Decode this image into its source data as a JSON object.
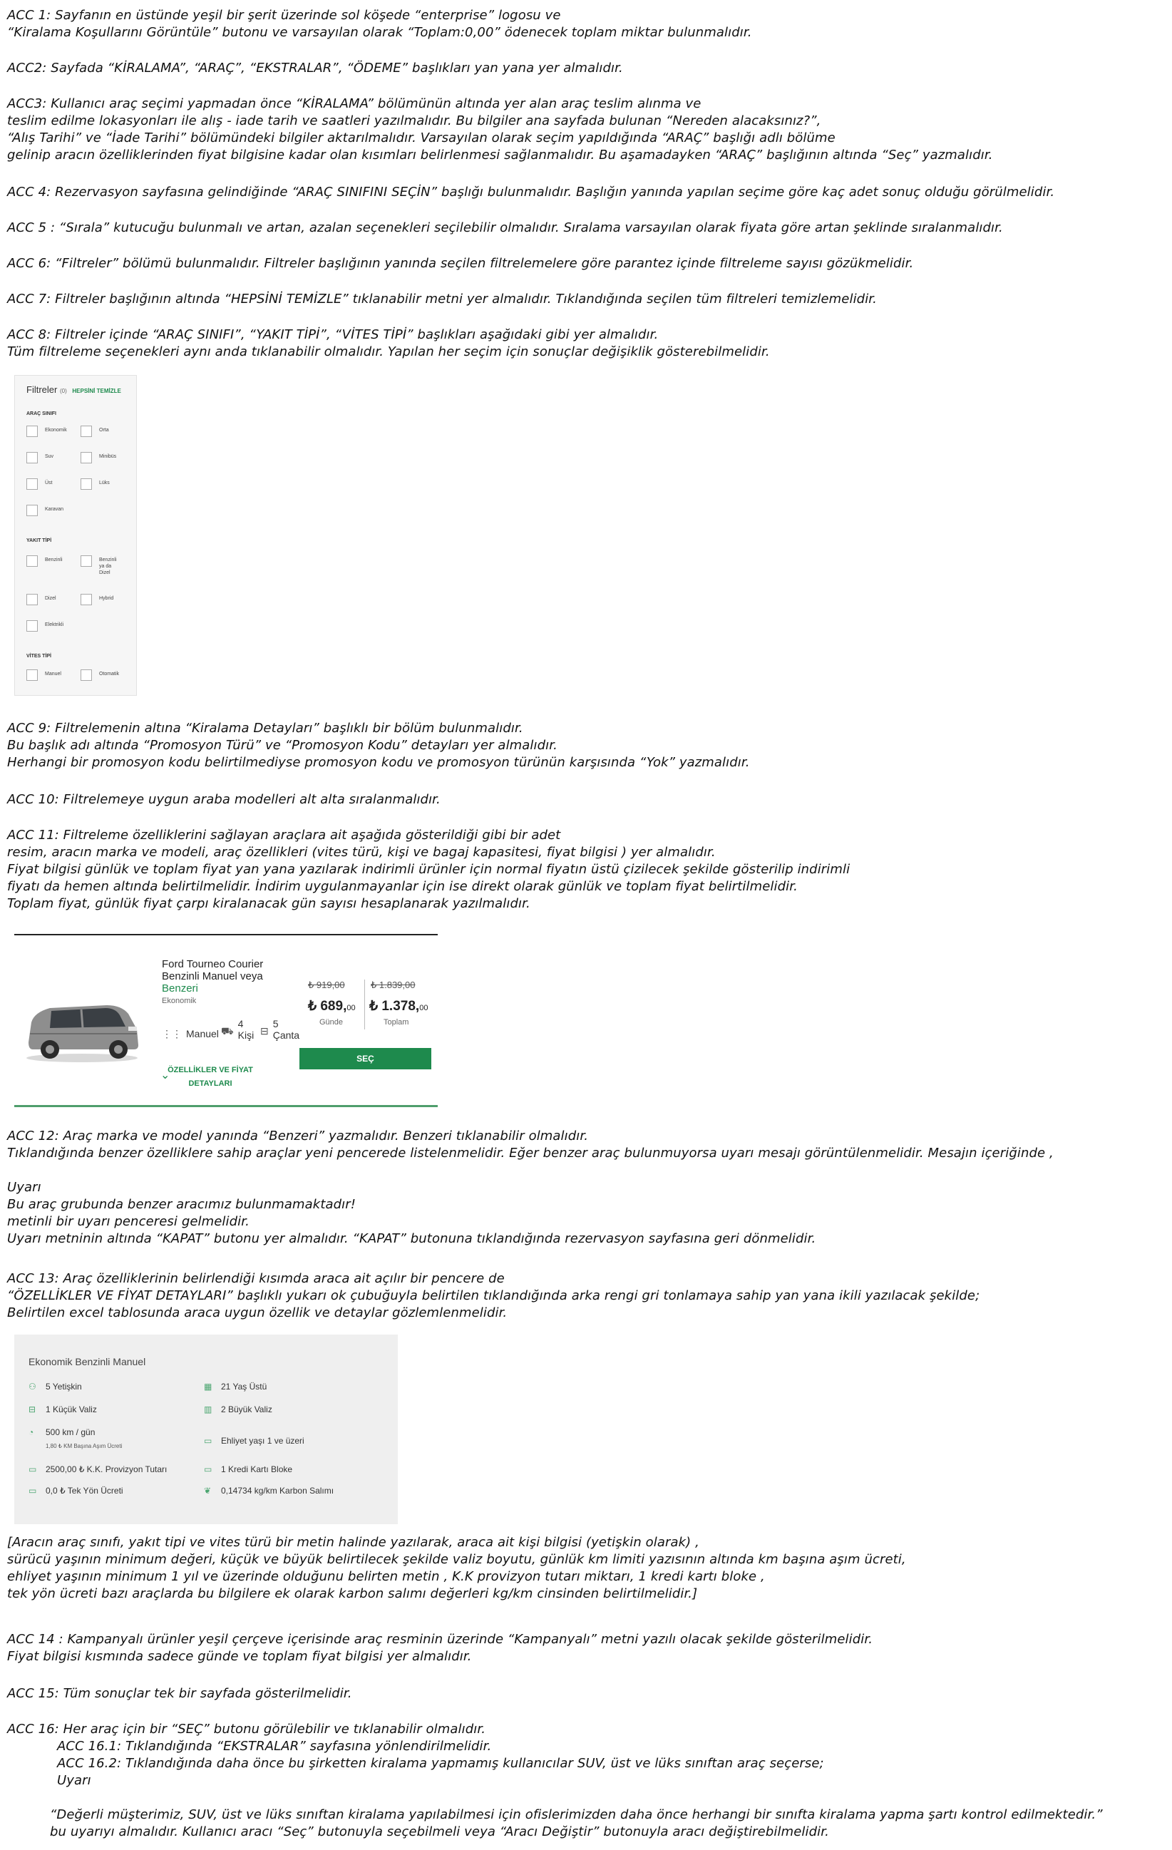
{
  "acc1": {
    "l1": "ACC 1: Sayfanın en üstünde yeşil bir şerit üzerinde sol köşede “enterprise” logosu ve",
    "l2": "“Kiralama Koşullarını Görüntüle” butonu ve varsayılan olarak  “Toplam:0,00” ödenecek toplam miktar bulunmalıdır."
  },
  "acc2": {
    "l1": "ACC2: Sayfada “KİRALAMA”, “ARAÇ”, “EKSTRALAR”, “ÖDEME” başlıkları yan yana yer almalıdır."
  },
  "acc3": {
    "l1": "ACC3: Kullanıcı araç seçimi yapmadan önce “KİRALAMA” bölümünün altında yer alan araç teslim alınma ve",
    "l2": "teslim edilme lokasyonları ile alış - iade tarih ve saatleri  yazılmalıdır. Bu bilgiler ana sayfada bulunan “Nereden alacaksınız?”,",
    "l3": "“Alış Tarihi” ve “İade Tarihi” bölümündeki bilgiler aktarılmalıdır. Varsayılan olarak seçim yapıldığında  “ARAÇ” başlığı adlı bölüme",
    "l4": "gelinip aracın özelliklerinden fiyat bilgisine kadar olan kısımları belirlenmesi sağlanmalıdır. Bu aşamadayken “ARAÇ” başlığının altında “Seç” yazmalıdır."
  },
  "acc4": {
    "l1": "ACC 4: Rezervasyon sayfasına gelindiğinde “ARAÇ SINIFINI SEÇİN” başlığı bulunmalıdır. Başlığın yanında yapılan seçime göre  kaç adet sonuç olduğu görülmelidir."
  },
  "acc5": {
    "l1": "ACC 5 : “Sırala” kutucuğu bulunmalı ve artan, azalan seçenekleri seçilebilir olmalıdır. Sıralama varsayılan olarak fiyata göre artan şeklinde sıralanmalıdır."
  },
  "acc6": {
    "l1": "ACC 6: “Filtreler” bölümü bulunmalıdır. Filtreler başlığının yanında seçilen filtrelemelere göre parantez içinde filtreleme sayısı gözükmelidir."
  },
  "acc7": {
    "l1": "ACC 7: Filtreler başlığının altında “HEPSİNİ TEMİZLE” tıklanabilir metni yer almalıdır. Tıklandığında seçilen tüm filtreleri temizlemelidir."
  },
  "acc8": {
    "l1": "ACC 8: Filtreler içinde “ARAÇ SINIFI”, “YAKIT TİPİ”, “VİTES TİPİ”  başlıkları aşağıdaki gibi yer almalıdır.",
    "l2": "Tüm filtreleme seçenekleri aynı anda tıklanabilir olmalıdır. Yapılan her seçim için sonuçlar değişiklik gösterebilmelidir."
  },
  "filter_panel": {
    "title": "Filtreler",
    "count": "(0)",
    "clear_all": "HEPSİNİ TEMİZLE",
    "class_heading": "ARAÇ SINIFI",
    "class_options": [
      "Ekonomik",
      "Orta",
      "Suv",
      "Minibüs",
      "Üst",
      "Lüks",
      "Karavan"
    ],
    "fuel_heading": "YAKIT TİPİ",
    "fuel_options": [
      "Benzinli",
      "Benzinli ya da Dizel",
      "Dizel",
      "Hybrid",
      "Elektrikli"
    ],
    "gear_heading": "VİTES TİPİ",
    "gear_options": [
      "Manuel",
      "Otomatik"
    ]
  },
  "acc9": {
    "l1": "ACC 9: Filtrelemenin altına “Kiralama Detayları” başlıklı bir bölüm bulunmalıdır.",
    "l2": "Bu başlık adı altında “Promosyon Türü” ve “Promosyon Kodu” detayları yer almalıdır.",
    "l3": "Herhangi bir promosyon kodu belirtilmediyse promosyon kodu ve promosyon türünün karşısında “Yok” yazmalıdır."
  },
  "acc10": {
    "l1": "ACC 10: Filtrelemeye uygun araba modelleri alt alta sıralanmalıdır."
  },
  "acc11": {
    "l1": "ACC 11: Filtreleme özelliklerini sağlayan araçlara ait aşağıda gösterildiği gibi bir adet",
    "l2": "resim, aracın marka ve modeli, araç özellikleri (vites türü, kişi ve bagaj kapasitesi, fiyat bilgisi ) yer almalıdır.",
    "l3": "Fiyat bilgisi günlük ve toplam fiyat yan yana yazılarak indirimli ürünler için normal fiyatın üstü çizilecek şekilde gösterilip indirimli",
    "l4": "fiyatı da hemen altında belirtilmelidir. İndirim uygulanmayanlar için ise direkt olarak günlük ve toplam fiyat belirtilmelidir.",
    "l5": "Toplam fiyat, günlük fiyat çarpı kiralanacak gün sayısı hesaplanarak yazılmalıdır."
  },
  "car_card": {
    "name_l1": "Ford Tourneo Courier",
    "name_l2": "Benzinli Manuel veya",
    "similar": "Benzeri",
    "class": "Ekonomik",
    "gear": "Manuel",
    "persons_n": "4",
    "persons_l": "Kişi",
    "bags_n": "5",
    "bags_l": "Çanta",
    "daily_old": "₺ 919,00",
    "daily_new": "₺ 689,",
    "daily_new_dec": "00",
    "daily_label": "Günde",
    "total_old": "₺ 1.839,00",
    "total_new": "₺ 1.378,",
    "total_new_dec": "00",
    "total_label": "Toplam",
    "select_btn": "SEÇ",
    "details_l1": "ÖZELLİKLER VE FİYAT",
    "details_l2": "DETAYLARI"
  },
  "acc12": {
    "l1": "ACC 12: Araç marka ve model yanında “Benzeri” yazmalıdır. Benzeri  tıklanabilir olmalıdır.",
    "l2": "Tıklandığında benzer özelliklere sahip araçlar yeni pencerede listelenmelidir. Eğer benzer araç bulunmuyorsa uyarı mesajı görüntülenmelidir. Mesajın içeriğinde ,",
    "l3": "Uyarı",
    "l4": "Bu araç grubunda benzer aracımız bulunmamaktadır!",
    "l5": "metinli bir uyarı penceresi gelmelidir.",
    "l6": "Uyarı metninin altında “KAPAT” butonu yer almalıdır. “KAPAT” butonuna tıklandığında rezervasyon sayfasına geri dönmelidir."
  },
  "acc13": {
    "l1": "ACC 13: Araç özelliklerinin belirlendiği kısımda araca ait açılır bir pencere de",
    "l2": "“ÖZELLİKLER VE FİYAT DETAYLARI” başlıklı yukarı ok çubuğuyla belirtilen tıklandığında arka rengi gri tonlamaya sahip yan yana ikili yazılacak şekilde;",
    "l3": "Belirtilen excel tablosunda araca uygun özellik ve detaylar gözlemlenmelidir."
  },
  "details_panel": {
    "title": "Ekonomik Benzinli Manuel",
    "adults": "5 Yetişkin",
    "age": "21 Yaş Üstü",
    "small_bag": "1 Küçük Valiz",
    "big_bag": "2 Büyük Valiz",
    "km": "500 km / gün",
    "km_sub": "1,80 ₺ KM Başına Aşım Ücreti",
    "license": "Ehliyet yaşı 1 ve üzeri",
    "provision": "2500,00 ₺ K.K. Provizyon Tutarı",
    "card_block": "1 Kredi Kartı Bloke",
    "one_way": "0,0 ₺ Tek Yön Ücreti",
    "carbon": "0,14734 kg/km Karbon Salımı"
  },
  "acc13b": {
    "l1": "[Aracın araç sınıfı, yakıt tipi ve vites türü bir metin halinde yazılarak, araca ait kişi bilgisi (yetişkin olarak) ,",
    "l2": "sürücü yaşının minimum değeri, küçük ve büyük belirtilecek şekilde valiz boyutu, günlük km limiti yazısının altında km başına aşım ücreti,",
    "l3": "ehliyet yaşının minimum 1 yıl ve üzerinde olduğunu belirten metin , K.K provizyon tutarı miktarı, 1 kredi kartı bloke ,",
    "l4": "tek yön ücreti bazı araçlarda bu bilgilere ek olarak karbon salımı değerleri kg/km cinsinden belirtilmelidir.]"
  },
  "acc14": {
    "l1": "ACC 14 : Kampanyalı ürünler yeşil çerçeve içerisinde araç resminin üzerinde “Kampanyalı” metni yazılı olacak şekilde gösterilmelidir.",
    "l2": "Fiyat bilgisi kısmında sadece günde ve toplam fiyat bilgisi yer almalıdır."
  },
  "acc15": {
    "l1": "ACC 15: Tüm sonuçlar tek bir sayfada gösterilmelidir."
  },
  "acc16": {
    "l1": "ACC 16: Her araç için bir “SEÇ” butonu görülebilir ve tıklanabilir olmalıdır.",
    "l2": "ACC 16.1: Tıklandığında “EKSTRALAR” sayfasına yönlendirilmelidir.",
    "l3": "ACC 16.2: Tıklandığında daha önce bu şirketten kiralama yapmamış kullanıcılar SUV, üst ve lüks sınıftan araç seçerse;",
    "l4": "Uyarı",
    "l5": "“Değerli müşterimiz, SUV, üst ve lüks sınıftan kiralama yapılabilmesi için ofislerimizden daha önce herhangi bir sınıfta kiralama yapma şartı kontrol edilmektedir.”",
    "l6": "bu uyarıyı almalıdır. Kullanıcı aracı  “Seç” butonuyla seçebilmeli veya “Aracı Değiştir” butonuyla aracı değiştirebilmelidir."
  },
  "colors": {
    "accent_green": "#1e8a4d",
    "panel_grey": "#efefef"
  }
}
